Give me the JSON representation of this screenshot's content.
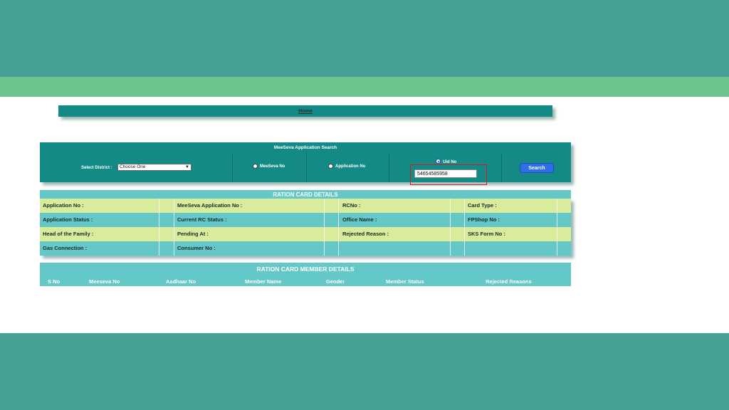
{
  "home": {
    "label": "Home"
  },
  "search": {
    "title": "MeeSeva Application Search",
    "district_label": "Select District :",
    "district_value": "Choose One",
    "option_meeseva": "MeeSeva No",
    "option_application": "Application No",
    "option_uid": "Uid No",
    "uid_value": "54654585958",
    "button_label": "Search"
  },
  "ration_card": {
    "title": "RATION CARD DETAILS",
    "rows": [
      [
        "Application No :",
        "MeeSeva Application No :",
        "RCNo :",
        "Card Type :"
      ],
      [
        "Application Status :",
        "Current RC Status :",
        "Office Name :",
        "FPShop No :"
      ],
      [
        "Head of the Family :",
        "Pending At :",
        "Rejected Reason :",
        "SKS Form No :"
      ],
      [
        "Gas Connection :",
        "Consumer No :",
        "",
        ""
      ]
    ]
  },
  "members": {
    "title": "RATION CARD MEMBER DETAILS",
    "columns": [
      "S No",
      "Meeseva No",
      "Aadhaar No",
      "Member Name",
      "Gender",
      "Member Status",
      "Rejected Reasons"
    ]
  },
  "colors": {
    "band": "#45a093",
    "green_band": "#6cc48e",
    "panel": "#138a85",
    "row_yellow": "#d8ec9c",
    "row_teal": "#64c8c8",
    "search_button": "#2f6ee8",
    "highlight": "#cc2020"
  }
}
